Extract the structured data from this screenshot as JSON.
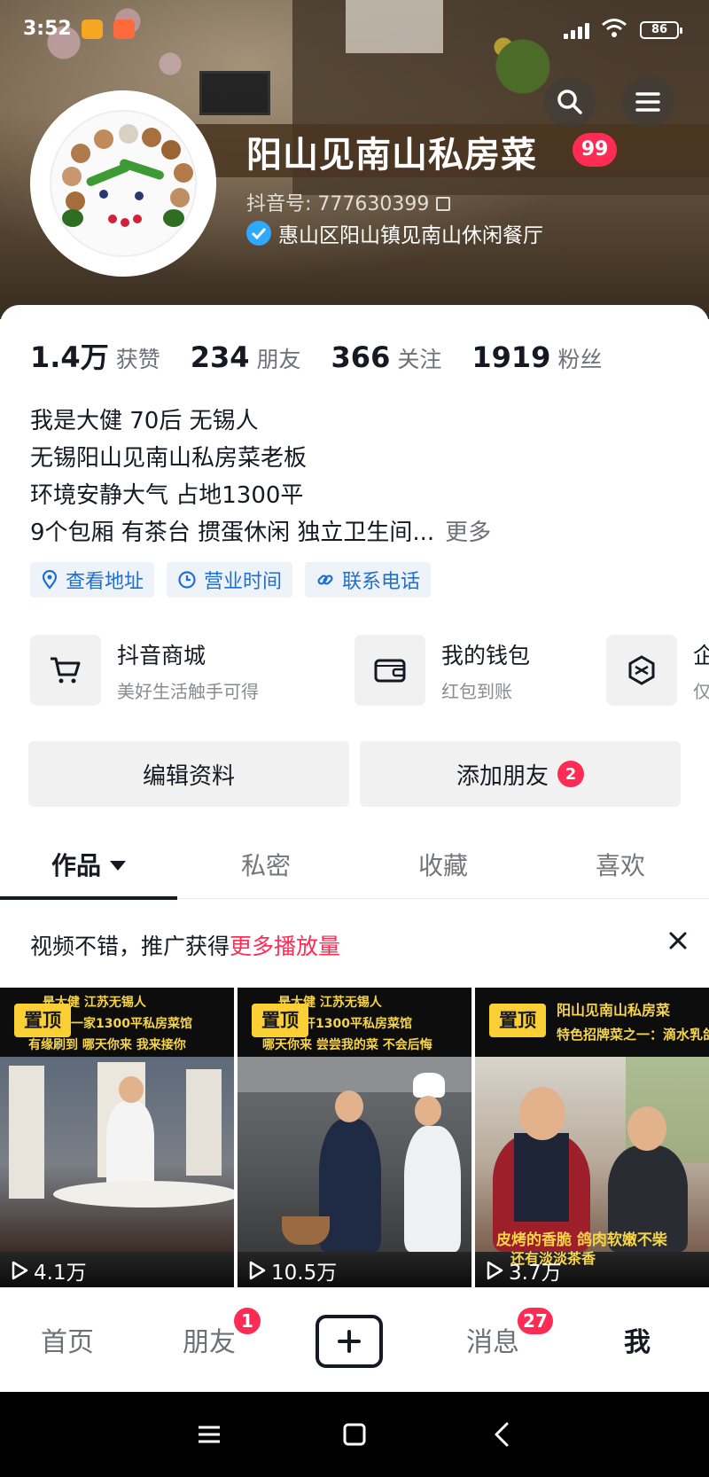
{
  "status_bar": {
    "time": "3:52",
    "battery": "86"
  },
  "profile": {
    "name": "阳山见南山私房菜",
    "level": "99",
    "douyin_id": "抖音号: 777630399",
    "verified_text": "惠山区阳山镇见南山休闲餐厅"
  },
  "stats": [
    {
      "num": "1.4万",
      "label": "获赞"
    },
    {
      "num": "234",
      "label": "朋友"
    },
    {
      "num": "366",
      "label": "关注"
    },
    {
      "num": "1919",
      "label": "粉丝"
    }
  ],
  "bio": {
    "lines": [
      "我是大健 70后 无锡人",
      "无锡阳山见南山私房菜老板",
      "环境安静大气 占地1300平",
      "9个包厢 有茶台 掼蛋休闲 独立卫生间..."
    ],
    "more": "更多"
  },
  "tags": [
    {
      "label": "查看地址",
      "icon": "location-pin-icon"
    },
    {
      "label": "营业时间",
      "icon": "clock-icon"
    },
    {
      "label": "联系电话",
      "icon": "phone-icon"
    }
  ],
  "services": [
    {
      "title": "抖音商城",
      "subtitle": "美好生活触手可得",
      "icon": "cart-icon"
    },
    {
      "title": "我的钱包",
      "subtitle": "红包到账",
      "icon": "wallet-icon"
    },
    {
      "title": "企",
      "subtitle": "仅",
      "icon": "enterprise-icon"
    }
  ],
  "actions": {
    "edit": "编辑资料",
    "add_friend": "添加朋友",
    "add_friend_count": "2"
  },
  "tabs": [
    "作品",
    "私密",
    "收藏",
    "喜欢"
  ],
  "promo": {
    "text": "视频不错，推广获得",
    "highlight": "更多播放量"
  },
  "videos": [
    {
      "pinned": "置顶",
      "caption_lines": [
        "是大健 江苏无锡人",
        "开一家1300平私房菜馆",
        "有缘刷到 哪天你来 我来接你"
      ],
      "plays": "4.1万"
    },
    {
      "pinned": "置顶",
      "caption_lines": [
        "是大健 江苏无锡人",
        "山开1300平私房菜馆",
        "哪天你来 尝尝我的菜 不会后悔"
      ],
      "plays": "10.5万"
    },
    {
      "pinned": "置顶",
      "caption_lines": [
        "阳山见南山私房菜",
        "特色招牌菜之一：滴水乳鸽"
      ],
      "overlay_lines": [
        "皮烤的香脆 鸽肉软嫩不柴",
        "还有淡淡茶香"
      ],
      "plays": "3.7万"
    }
  ],
  "bottom_nav": {
    "home": "首页",
    "friends": "朋友",
    "friends_badge": "1",
    "messages": "消息",
    "messages_badge": "27",
    "me": "我"
  },
  "colors": {
    "accent": "#fe2c55",
    "link": "#1f6fd1",
    "pin": "#fbd034"
  }
}
